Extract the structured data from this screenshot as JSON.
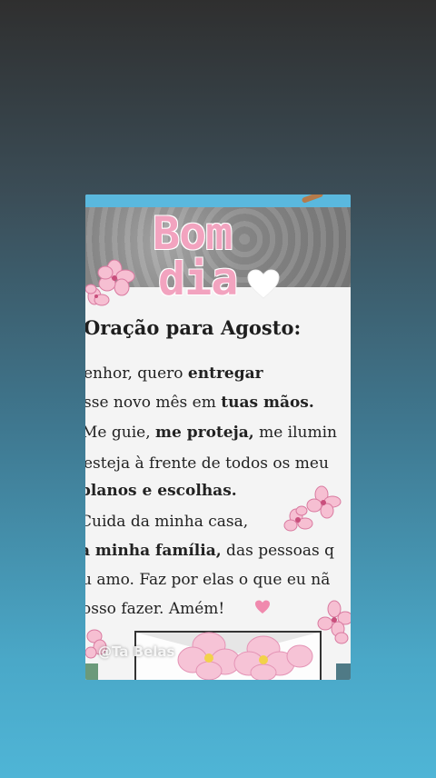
{
  "story": {
    "title_line1": "Bom",
    "title_line2": "dia",
    "prayer_title": "Oração para Agosto:",
    "lines": [
      {
        "parts": [
          "enhor, quero ",
          "entregar",
          ""
        ]
      },
      {
        "parts": [
          "sse novo mês em ",
          "tuas mãos.",
          ""
        ]
      },
      {
        "parts": [
          "Me guie, ",
          "me proteja,",
          " me ilumin"
        ]
      },
      {
        "parts": [
          " esteja à frente de todos os meu",
          "",
          ""
        ]
      },
      {
        "parts": [
          "",
          "planos e escolhas.",
          ""
        ]
      },
      {
        "parts": [
          "Cuida da minha casa,",
          "",
          ""
        ]
      },
      {
        "parts": [
          "",
          "a minha família,",
          " das pessoas q"
        ]
      },
      {
        "parts": [
          "u amo. Faz por elas o que eu nã",
          "",
          ""
        ]
      },
      {
        "parts": [
          "osso fazer. Amém!",
          "",
          ""
        ]
      }
    ],
    "watermark": "@Ta      Belas",
    "colors": {
      "title_pink": "#f2a3bf",
      "heart_pink": "#f08aae",
      "top_bar": "#5ab8de"
    },
    "icons": [
      "heart-icon",
      "flower-icon",
      "envelope-icon"
    ]
  }
}
